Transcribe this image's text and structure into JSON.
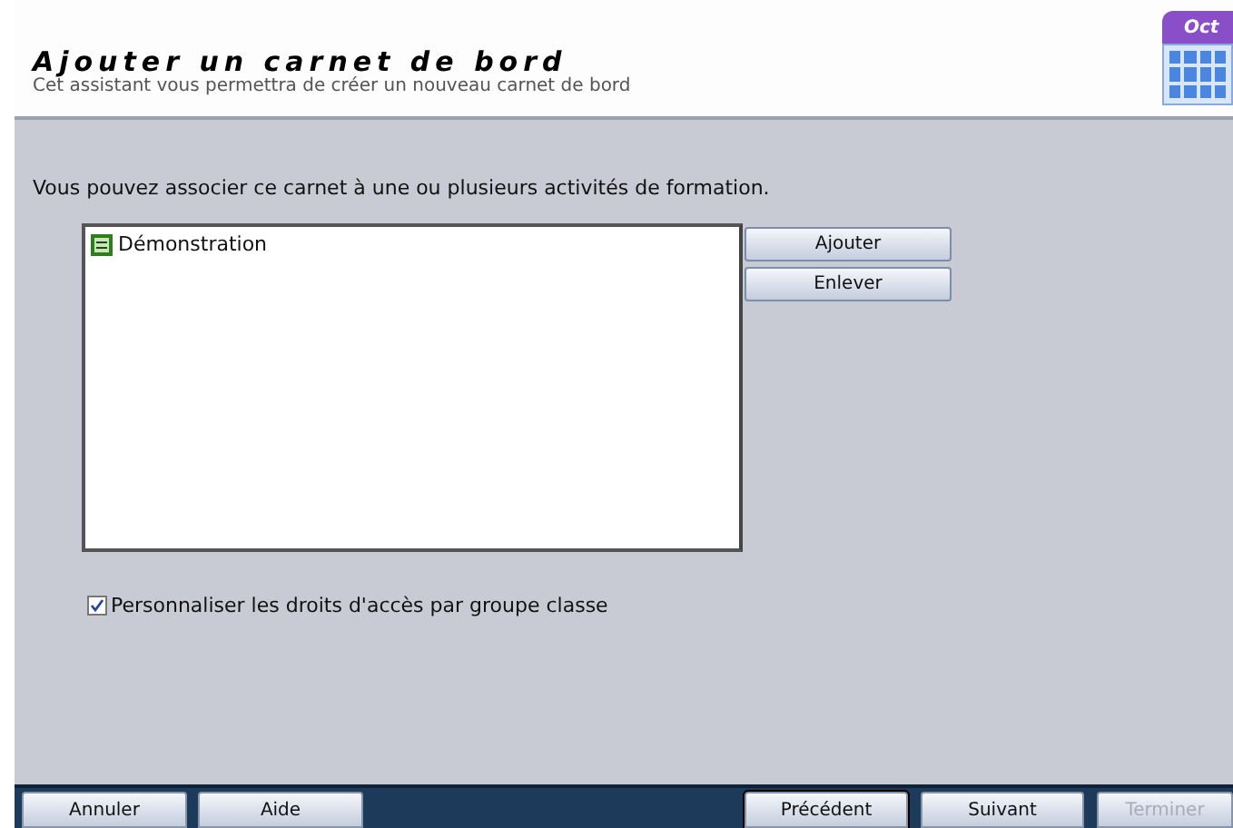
{
  "header": {
    "title": "Ajouter un carnet de bord",
    "subtitle": "Cet assistant vous permettra de créer un nouveau carnet de bord",
    "calendar_label": "Oct"
  },
  "prompt": "Vous pouvez associer ce carnet à une ou plusieurs activités de formation.",
  "activities": [
    {
      "label": "Démonstration",
      "selected": false
    }
  ],
  "list_buttons": [
    "Ajouter",
    "Enlever"
  ],
  "option": {
    "label": "Personnaliser les droits d'accès par groupe classe",
    "checked": true
  },
  "footer": {
    "left": [
      {
        "label": "Annuler",
        "disabled": false
      },
      {
        "label": "Aide",
        "disabled": false
      }
    ],
    "right": [
      {
        "label": "Précédent",
        "disabled": false,
        "default": true
      },
      {
        "label": "Suivant",
        "disabled": false,
        "default": false
      },
      {
        "label": "Terminer",
        "disabled": true,
        "default": false
      }
    ]
  }
}
